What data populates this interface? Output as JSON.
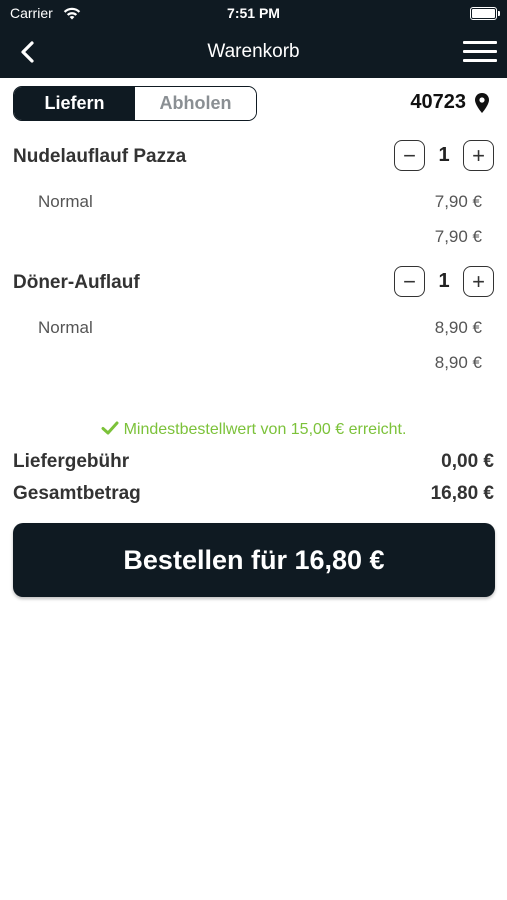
{
  "statusbar": {
    "carrier": "Carrier",
    "time": "7:51 PM"
  },
  "navbar": {
    "title": "Warenkorb"
  },
  "segment": {
    "deliver_label": "Liefern",
    "pickup_label": "Abholen",
    "selected": "Liefern"
  },
  "location": {
    "zip": "40723"
  },
  "cart": {
    "items": [
      {
        "name": "Nudelauflauf Pazza",
        "quantity": "1",
        "variant": "Normal",
        "variant_price": "7,90 €",
        "subtotal": "7,90 €"
      },
      {
        "name": "Döner-Auflauf",
        "quantity": "1",
        "variant": "Normal",
        "variant_price": "8,90 €",
        "subtotal": "8,90 €"
      }
    ]
  },
  "stepper": {
    "minus": "−",
    "plus": "+"
  },
  "min_order": {
    "message": "Mindestbestellwert von 15,00 € erreicht."
  },
  "summary": {
    "delivery_fee_label": "Liefergebühr",
    "delivery_fee_value": "0,00 €",
    "total_label": "Gesamtbetrag",
    "total_value": "16,80 €"
  },
  "order_button": {
    "label": "Bestellen für 16,80 €"
  },
  "colors": {
    "navbar": "#0f1a22",
    "accent_green": "#7cc23a",
    "text": "#333333"
  },
  "icons": [
    "wifi-icon",
    "battery-icon",
    "back-arrow-icon",
    "hamburger-menu-icon",
    "location-pin-icon",
    "minus-icon",
    "plus-icon",
    "checkmark-icon"
  ]
}
